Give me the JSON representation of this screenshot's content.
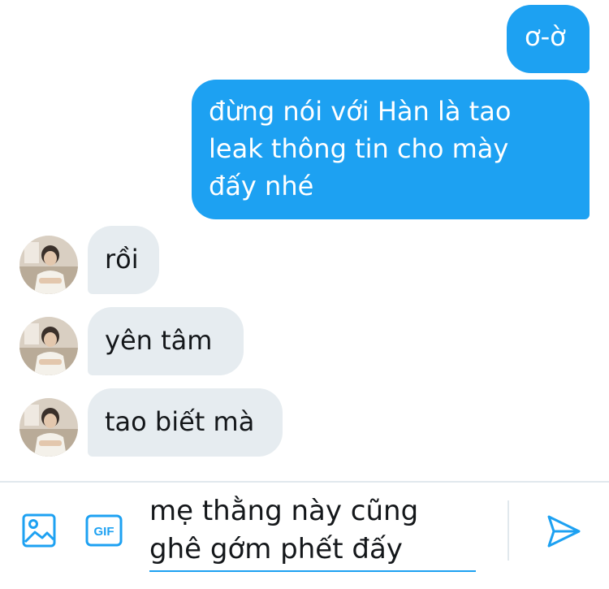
{
  "messages": [
    {
      "side": "sent",
      "text": "ơ-ờ"
    },
    {
      "side": "sent",
      "text": "đừng nói với Hàn là tao\nleak thông tin cho mày\nđấy nhé"
    },
    {
      "side": "received",
      "text": "rồi"
    },
    {
      "side": "received",
      "text": "yên tâm"
    },
    {
      "side": "received",
      "text": "tao biết mà"
    }
  ],
  "composer": {
    "draft_text": "mẹ thằng này cũng\nghê gớm phết đấy",
    "gif_label": "GIF"
  },
  "icons": {
    "image": "image-icon",
    "gif": "gif-icon",
    "send": "send-icon",
    "avatar": "avatar-photo"
  },
  "colors": {
    "accent": "#1da1f2",
    "received_bubble": "#e6ecf0",
    "text_dark": "#14171a",
    "divider": "#e1e8ed"
  }
}
